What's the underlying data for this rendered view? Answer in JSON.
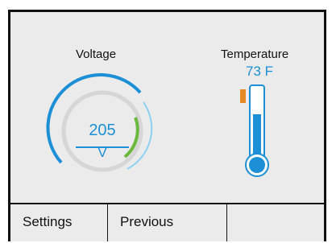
{
  "voltage": {
    "title": "Voltage",
    "value": "205",
    "unit": "V"
  },
  "temperature": {
    "title": "Temperature",
    "value": "73 F"
  },
  "menu": {
    "buttons": [
      {
        "label": "Settings"
      },
      {
        "label": "Previous"
      },
      {
        "label": ""
      }
    ]
  },
  "colors": {
    "accent_blue": "#1c8fd6",
    "light_blue": "#8fd0f2",
    "green": "#6cb83e",
    "orange": "#e58a24",
    "track_gray": "#d6d6d6",
    "panel_bg": "#ebebeb"
  }
}
